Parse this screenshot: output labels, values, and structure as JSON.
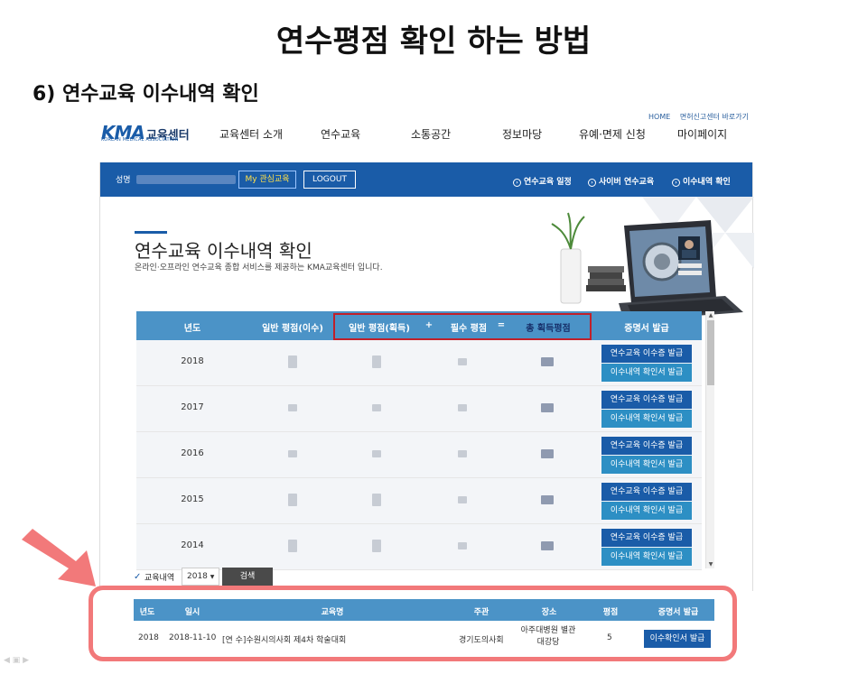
{
  "slide": {
    "title": "연수평점 확인 하는 방법",
    "subtitle": "6) 연수교육 이수내역 확인"
  },
  "site": {
    "logo_mark": "KMA",
    "logo_text": "교육센터",
    "logo_sub": "KOREAN MEDICAL ASSOCIATION",
    "top_links": [
      "HOME",
      "면허신고센터 바로가기"
    ],
    "nav": [
      "교육센터 소개",
      "연수교육",
      "소통공간",
      "정보마당",
      "유예·면제 신청",
      "마이페이지"
    ]
  },
  "userbar": {
    "name_label": "성명",
    "my_interest": "My 관심교육",
    "logout": "LOGOUT",
    "quick_links": [
      "연수교육 일정",
      "사이버 연수교육",
      "이수내역 확인"
    ]
  },
  "page": {
    "heading": "연수교육 이수내역 확인",
    "description": "온라인·오프라인 연수교육 종합 서비스를 제공하는 KMA교육센터 입니다."
  },
  "summary_table": {
    "headers": {
      "year": "년도",
      "general_completed": "일반 평점(이수)",
      "general_earned": "일반 평점(획득)",
      "plus": "+",
      "required": "필수 평점",
      "equals": "=",
      "total": "총 획득평점",
      "certificate": "증명서 발급"
    },
    "rows": [
      {
        "year": "2018",
        "btn_cert": "연수교육 이수증 발급",
        "btn_confirm": "이수내역 확인서 발급"
      },
      {
        "year": "2017",
        "btn_cert": "연수교육 이수증 발급",
        "btn_confirm": "이수내역 확인서 발급"
      },
      {
        "year": "2016",
        "btn_cert": "연수교육 이수증 발급",
        "btn_confirm": "이수내역 확인서 발급"
      },
      {
        "year": "2015",
        "btn_cert": "연수교육 이수증 발급",
        "btn_confirm": "이수내역 확인서 발급"
      },
      {
        "year": "2014",
        "btn_cert": "연수교육 이수증 발급",
        "btn_confirm": "이수내역 확인서 발급"
      }
    ]
  },
  "search": {
    "label": "교육내역",
    "year_value": "2018",
    "button": "검색"
  },
  "history_table": {
    "headers": [
      "년도",
      "일시",
      "교육명",
      "주관",
      "장소",
      "평점",
      "증명서 발급"
    ],
    "row": {
      "year": "2018",
      "date": "2018-11-10",
      "name": "[연 수]수원시의사회 제4차 학술대회",
      "host": "경기도의사회",
      "place": "아주대병원 별관 대강당",
      "score": "5",
      "button": "이수확인서 발급"
    }
  },
  "colors": {
    "primary": "#1a5ca8",
    "table_header": "#4b93c7",
    "highlight_red": "#c0202a",
    "highlight_pink": "#f2797a"
  }
}
